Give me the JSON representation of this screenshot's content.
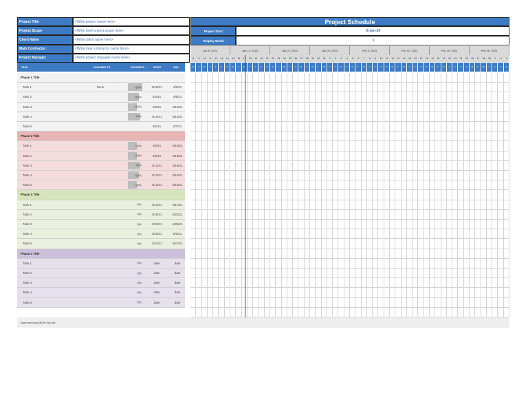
{
  "header": {
    "fields": [
      {
        "label": "Project Title",
        "value": "<Write project name here>"
      },
      {
        "label": "Project Scope",
        "value": "<Write brief project scope here>"
      },
      {
        "label": "Client Name",
        "value": "<Write client name here>"
      },
      {
        "label": "Main Contractor",
        "value": "<Write main contractor name here>"
      },
      {
        "label": "Project Manager",
        "value": "<Write project manager name here>"
      }
    ],
    "title": "Project Schedule",
    "project_start_label": "Project Start:",
    "project_start": "8-Jan-24",
    "display_week_label": "Display Week:",
    "display_week": "1"
  },
  "columns": {
    "task": "TASK",
    "assigned": "ASSIGNED TO",
    "progress": "PROGRESS",
    "start": "START",
    "end": "END"
  },
  "timeline": {
    "weeks": [
      "Jan 8, 2024",
      "Jan 15, 2024",
      "Jan 22, 2024",
      "Jan 29, 2024",
      "Feb 5, 2024",
      "Feb 12, 2024",
      "Feb 19, 2024",
      "Feb 26, 2024"
    ],
    "day_numbers": [
      "8",
      "9",
      "10",
      "11",
      "12",
      "13",
      "14",
      "15",
      "16",
      "17",
      "18",
      "19",
      "20",
      "21",
      "22",
      "23",
      "24",
      "25",
      "26",
      "27",
      "28",
      "29",
      "30",
      "31",
      "1",
      "2",
      "3",
      "4",
      "5",
      "6",
      "7",
      "8",
      "9",
      "10",
      "11",
      "12",
      "13",
      "14",
      "15",
      "16",
      "17",
      "18",
      "19",
      "20",
      "21",
      "22",
      "23",
      "24",
      "25",
      "26",
      "27",
      "28",
      "29",
      "1",
      "2",
      "3"
    ],
    "day_letters": [
      "M",
      "T",
      "W",
      "T",
      "F",
      "S",
      "S"
    ],
    "today_index": 9
  },
  "phases": [
    {
      "title": "Phase 1 Title",
      "color": "#f2f2f2",
      "title_color": "#f2f2f2",
      "tasks": [
        {
          "name": "Task 1",
          "assigned": "None",
          "progress": "80%",
          "pct": 80,
          "start": "3/26/21",
          "end": "4/6/21"
        },
        {
          "name": "Task 2",
          "assigned": "",
          "progress": "60%",
          "pct": 60,
          "start": "4/4/21",
          "end": "4/6/21"
        },
        {
          "name": "Task 3",
          "assigned": "",
          "progress": "50%",
          "pct": 50,
          "start": "4/6/21",
          "end": "4/10/21"
        },
        {
          "name": "Task 4",
          "assigned": "",
          "progress": "70%",
          "pct": 70,
          "start": "4/10/21",
          "end": "4/15/21"
        },
        {
          "name": "Task 5",
          "assigned": "",
          "progress": "",
          "pct": 0,
          "start": "4/5/21",
          "end": "4/7/21"
        }
      ]
    },
    {
      "title": "Phase 2 Title",
      "color": "#f5dcdc",
      "title_color": "#e8b4b4",
      "tasks": [
        {
          "name": "Task 1",
          "assigned": "",
          "progress": "50%",
          "pct": 50,
          "start": "4/6/21",
          "end": "4/10/21"
        },
        {
          "name": "Task 2",
          "assigned": "",
          "progress": "50%",
          "pct": 50,
          "start": "4/9/21",
          "end": "4/13/21"
        },
        {
          "name": "Task 3",
          "assigned": "",
          "progress": "70%",
          "pct": 70,
          "start": "4/13/21",
          "end": "4/16/21"
        },
        {
          "name": "Task 4",
          "assigned": "",
          "progress": "60%",
          "pct": 60,
          "start": "4/13/21",
          "end": "4/15/21"
        },
        {
          "name": "Task 5",
          "assigned": "",
          "progress": "50%",
          "pct": 50,
          "start": "4/13/21",
          "end": "4/16/21"
        }
      ]
    },
    {
      "title": "Phase 3 Title",
      "color": "#ebf0de",
      "title_color": "#d7e4bc",
      "tasks": [
        {
          "name": "Task 1",
          "assigned": "",
          "progress": "0%",
          "pct": 0,
          "start": "4/12/21",
          "end": "4/17/21"
        },
        {
          "name": "Task 2",
          "assigned": "",
          "progress": "0%",
          "pct": 0,
          "start": "4/18/21",
          "end": "4/22/21"
        },
        {
          "name": "Task 3",
          "assigned": "",
          "progress": "0%",
          "pct": 0,
          "start": "4/23/21",
          "end": "4/28/21"
        },
        {
          "name": "Task 4",
          "assigned": "",
          "progress": "0%",
          "pct": 0,
          "start": "4/29/21",
          "end": "5/3/21"
        },
        {
          "name": "Task 5",
          "assigned": "",
          "progress": "0%",
          "pct": 0,
          "start": "4/22/21",
          "end": "4/27/21"
        }
      ]
    },
    {
      "title": "Phase 4 Title",
      "color": "#e5e0ec",
      "title_color": "#ccc0da",
      "tasks": [
        {
          "name": "Task 1",
          "assigned": "",
          "progress": "0%",
          "pct": 0,
          "start": "date",
          "end": "date"
        },
        {
          "name": "Task 2",
          "assigned": "",
          "progress": "0%",
          "pct": 0,
          "start": "date",
          "end": "date"
        },
        {
          "name": "Task 3",
          "assigned": "",
          "progress": "0%",
          "pct": 0,
          "start": "date",
          "end": "date"
        },
        {
          "name": "Task 4",
          "assigned": "",
          "progress": "0%",
          "pct": 0,
          "start": "date",
          "end": "date"
        },
        {
          "name": "Task 5",
          "assigned": "",
          "progress": "0%",
          "pct": 0,
          "start": "date",
          "end": "date"
        }
      ]
    }
  ],
  "footer_note": "Insert new rows ABOVE this one",
  "colors": {
    "accent": "#3d7bc4",
    "today_line": "#1f3b66"
  }
}
